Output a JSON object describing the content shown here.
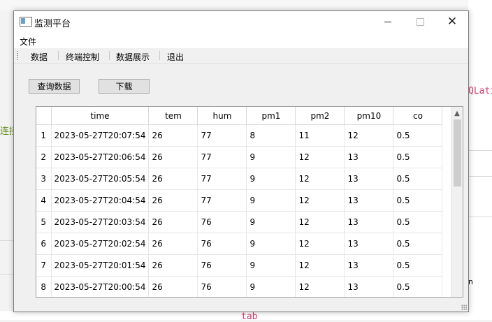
{
  "background": {
    "left_green_text": "连接",
    "right_pink_text": "QLati",
    "right_small_text": "n",
    "bottom_pink_text": "tab"
  },
  "window": {
    "title": "监测平台",
    "menu": {
      "file": "文件"
    },
    "toolbar": [
      "数据",
      "终端控制",
      "数据展示",
      "退出"
    ],
    "buttons": {
      "query": "查询数据",
      "download": "下载"
    },
    "table": {
      "columns": [
        "time",
        "tem",
        "hum",
        "pm1",
        "pm2",
        "pm10",
        "co"
      ],
      "rows": [
        {
          "num": "1",
          "time": "2023-05-27T20:07:54",
          "tem": "26",
          "hum": "77",
          "pm1": "8",
          "pm2": "11",
          "pm10": "12",
          "co": "0.5"
        },
        {
          "num": "2",
          "time": "2023-05-27T20:06:54",
          "tem": "26",
          "hum": "77",
          "pm1": "9",
          "pm2": "12",
          "pm10": "13",
          "co": "0.5"
        },
        {
          "num": "3",
          "time": "2023-05-27T20:05:54",
          "tem": "26",
          "hum": "77",
          "pm1": "9",
          "pm2": "12",
          "pm10": "13",
          "co": "0.5"
        },
        {
          "num": "4",
          "time": "2023-05-27T20:04:54",
          "tem": "26",
          "hum": "77",
          "pm1": "9",
          "pm2": "12",
          "pm10": "13",
          "co": "0.5"
        },
        {
          "num": "5",
          "time": "2023-05-27T20:03:54",
          "tem": "26",
          "hum": "76",
          "pm1": "9",
          "pm2": "12",
          "pm10": "13",
          "co": "0.5"
        },
        {
          "num": "6",
          "time": "2023-05-27T20:02:54",
          "tem": "26",
          "hum": "76",
          "pm1": "9",
          "pm2": "12",
          "pm10": "13",
          "co": "0.5"
        },
        {
          "num": "7",
          "time": "2023-05-27T20:01:54",
          "tem": "26",
          "hum": "76",
          "pm1": "9",
          "pm2": "12",
          "pm10": "13",
          "co": "0.5"
        },
        {
          "num": "8",
          "time": "2023-05-27T20:00:54",
          "tem": "26",
          "hum": "76",
          "pm1": "9",
          "pm2": "12",
          "pm10": "13",
          "co": "0.5"
        }
      ]
    }
  }
}
